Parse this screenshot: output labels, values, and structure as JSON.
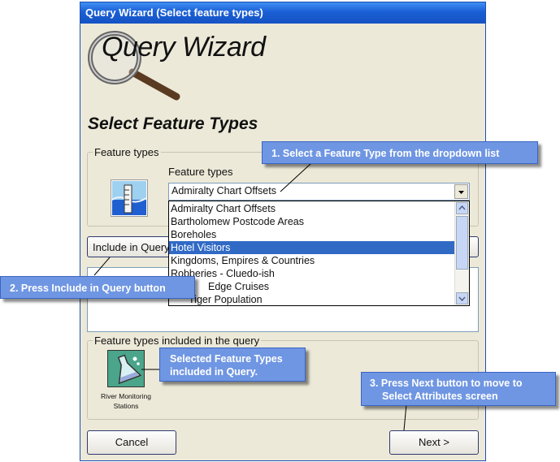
{
  "window": {
    "title": "Query Wizard (Select feature types)"
  },
  "logo": {
    "text": "Query Wizard"
  },
  "page_title": "Select Feature Types",
  "feature_group": {
    "legend": "Feature types",
    "dropdown_label": "Feature types",
    "selected_value": "Admiralty Chart Offsets",
    "options": [
      "Admiralty Chart Offsets",
      "Bartholomew Postcode Areas",
      "Boreholes",
      "Hotel Visitors",
      "Kingdoms, Empires & Countries",
      "Robberies - Cluedo-ish",
      "Edge Cruises",
      "Tiger Population"
    ],
    "highlighted_index": 3
  },
  "include_button": {
    "label": "Include in Query"
  },
  "included_group": {
    "legend": "Feature types included in the query",
    "items": [
      {
        "label": "River Monitoring Stations",
        "icon": "flask-icon"
      }
    ]
  },
  "buttons": {
    "cancel": "Cancel",
    "next": "Next >"
  },
  "callouts": {
    "c1": "1. Select a Feature Type from the dropdown list",
    "c2": "2. Press Include in Query button",
    "c3_line1": "Selected Feature Types",
    "c3_line2": "included in Query.",
    "c4_line1": "3. Press  Next button to move to",
    "c4_line2": "Select Attributes screen"
  },
  "colors": {
    "titlebar": "#1a5fd5",
    "highlight": "#316ac5",
    "callout": "#6f96e2"
  }
}
